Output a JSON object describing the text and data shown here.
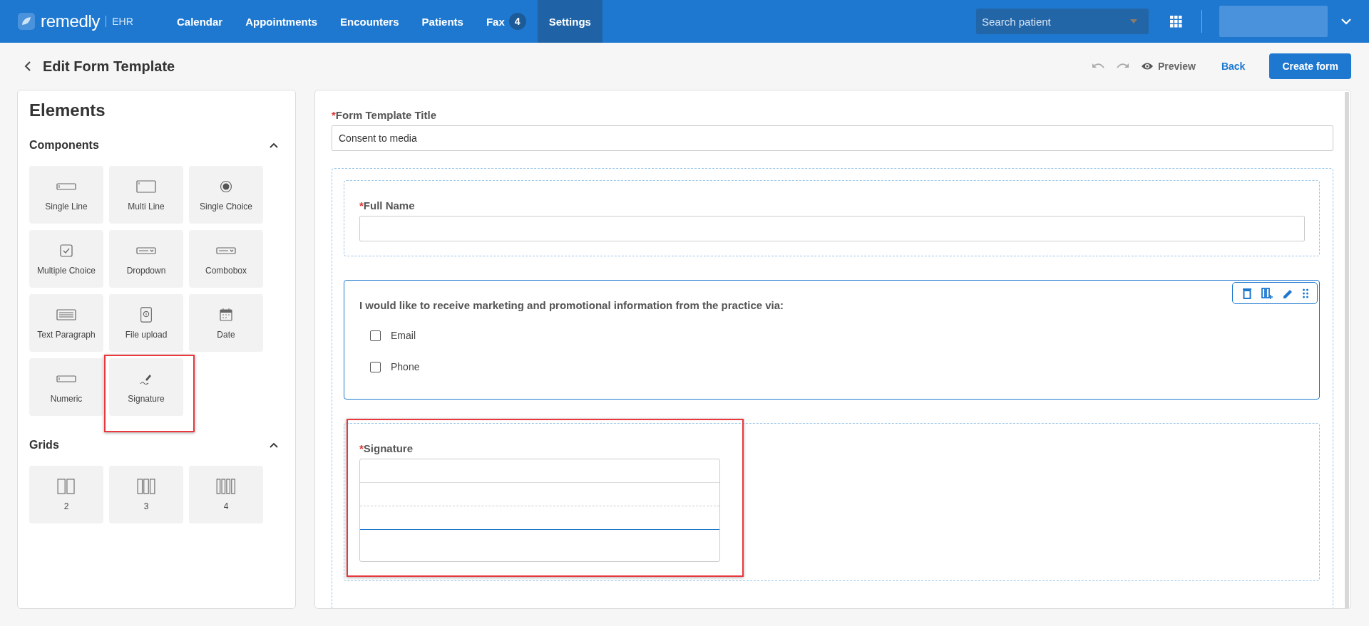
{
  "nav": {
    "brand": "remedly",
    "brand_suffix": "EHR",
    "items": [
      {
        "label": "Calendar",
        "selected": false
      },
      {
        "label": "Appointments",
        "selected": false
      },
      {
        "label": "Encounters",
        "selected": false
      },
      {
        "label": "Patients",
        "selected": false
      },
      {
        "label": "Fax",
        "selected": false,
        "badge": "4"
      },
      {
        "label": "Settings",
        "selected": true
      }
    ],
    "search": {
      "placeholder": "Search patient"
    }
  },
  "page": {
    "title": "Edit Form Template",
    "preview": "Preview",
    "back": "Back",
    "create": "Create form"
  },
  "elements_panel": {
    "title": "Elements",
    "sections": [
      {
        "title": "Components",
        "expanded": true,
        "items": [
          {
            "kind": "single-line",
            "label": "Single Line",
            "highlighted": false
          },
          {
            "kind": "multi-line",
            "label": "Multi Line",
            "highlighted": false
          },
          {
            "kind": "single-choice",
            "label": "Single Choice",
            "highlighted": false
          },
          {
            "kind": "multiple-choice",
            "label": "Multiple Choice",
            "highlighted": false
          },
          {
            "kind": "dropdown",
            "label": "Dropdown",
            "highlighted": false
          },
          {
            "kind": "combobox",
            "label": "Combobox",
            "highlighted": false
          },
          {
            "kind": "text-paragraph",
            "label": "Text Paragraph",
            "highlighted": false
          },
          {
            "kind": "file-upload",
            "label": "File upload",
            "highlighted": false
          },
          {
            "kind": "date",
            "label": "Date",
            "highlighted": false
          },
          {
            "kind": "numeric",
            "label": "Numeric",
            "highlighted": false
          },
          {
            "kind": "signature",
            "label": "Signature",
            "highlighted": true
          }
        ]
      },
      {
        "title": "Grids",
        "expanded": true,
        "items": [
          {
            "kind": "grid-2",
            "label": "2",
            "highlighted": false
          },
          {
            "kind": "grid-3",
            "label": "3",
            "highlighted": false
          },
          {
            "kind": "grid-4",
            "label": "4",
            "highlighted": false
          }
        ]
      }
    ]
  },
  "form": {
    "title_mark": "*",
    "title_label": "Form Template Title",
    "title_value": "Consent to media",
    "fields": [
      {
        "kind": "text",
        "required_mark": "*",
        "label": "Full Name",
        "selected": false,
        "highlighted": false
      },
      {
        "kind": "checkboxes",
        "label": "I would like to receive marketing and promotional information from the practice via:",
        "selected": true,
        "highlighted": false,
        "options": [
          {
            "label": "Email",
            "checked": false
          },
          {
            "label": "Phone",
            "checked": false
          }
        ]
      },
      {
        "kind": "signature",
        "required_mark": "*",
        "label": "Signature",
        "selected": false,
        "highlighted": true
      }
    ]
  }
}
